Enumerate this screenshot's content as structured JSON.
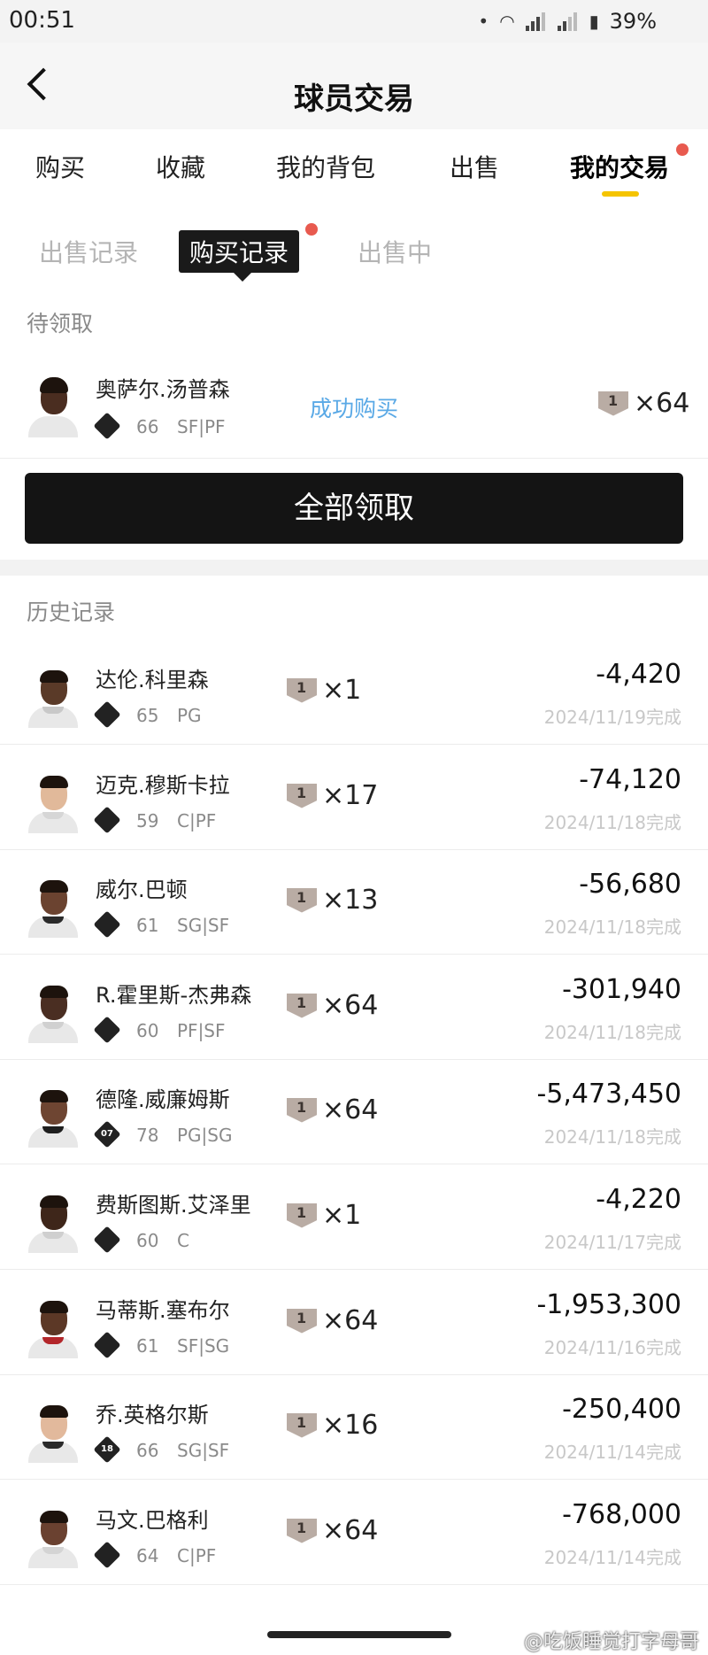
{
  "status_bar": {
    "time": "00:51",
    "battery": "39%"
  },
  "header": {
    "title": "球员交易"
  },
  "main_tabs": [
    {
      "label": "购买"
    },
    {
      "label": "收藏"
    },
    {
      "label": "我的背包"
    },
    {
      "label": "出售"
    },
    {
      "label": "我的交易"
    }
  ],
  "sub_tabs": [
    {
      "label": "出售记录"
    },
    {
      "label": "购买记录"
    },
    {
      "label": "出售中"
    }
  ],
  "pending": {
    "section_label": "待领取",
    "item": {
      "name": "奥萨尔.汤普森",
      "rating": "66",
      "position": "SF|PF",
      "status": "成功购买",
      "card_level": "1",
      "quantity": "×64"
    },
    "claim_all_label": "全部领取"
  },
  "history": {
    "section_label": "历史记录",
    "rows": [
      {
        "name": "达伦.科里森",
        "rating": "65",
        "position": "PG",
        "card_level": "1",
        "quantity": "×1",
        "amount": "-4,420",
        "date": "2024/11/19完成",
        "tier_label": "",
        "skin": "#5a3a28",
        "jersey": "#c8c8c8"
      },
      {
        "name": "迈克.穆斯卡拉",
        "rating": "59",
        "position": "C|PF",
        "card_level": "1",
        "quantity": "×17",
        "amount": "-74,120",
        "date": "2024/11/18完成",
        "tier_label": "",
        "skin": "#e1b99a",
        "jersey": "#d6d6d6"
      },
      {
        "name": "威尔.巴顿",
        "rating": "61",
        "position": "SG|SF",
        "card_level": "1",
        "quantity": "×13",
        "amount": "-56,680",
        "date": "2024/11/18完成",
        "tier_label": "",
        "skin": "#6b4330",
        "jersey": "#2a2a2a"
      },
      {
        "name": "R.霍里斯-杰弗森",
        "rating": "60",
        "position": "PF|SF",
        "card_level": "1",
        "quantity": "×64",
        "amount": "-301,940",
        "date": "2024/11/18完成",
        "tier_label": "",
        "skin": "#4a2e22",
        "jersey": "#d0d0d0"
      },
      {
        "name": "德隆.威廉姆斯",
        "rating": "78",
        "position": "PG|SG",
        "card_level": "1",
        "quantity": "×64",
        "amount": "-5,473,450",
        "date": "2024/11/18完成",
        "tier_label": "07",
        "skin": "#6e4532",
        "jersey": "#1e1e1e"
      },
      {
        "name": "费斯图斯.艾泽里",
        "rating": "60",
        "position": "C",
        "card_level": "1",
        "quantity": "×1",
        "amount": "-4,220",
        "date": "2024/11/17完成",
        "tier_label": "",
        "skin": "#3e261a",
        "jersey": "#cfcfcf"
      },
      {
        "name": "马蒂斯.塞布尔",
        "rating": "61",
        "position": "SF|SG",
        "card_level": "1",
        "quantity": "×64",
        "amount": "-1,953,300",
        "date": "2024/11/16完成",
        "tier_label": "",
        "skin": "#5c3826",
        "jersey": "#b3262a"
      },
      {
        "name": "乔.英格尔斯",
        "rating": "66",
        "position": "SG|SF",
        "card_level": "1",
        "quantity": "×16",
        "amount": "-250,400",
        "date": "2024/11/14完成",
        "tier_label": "18",
        "skin": "#e2b99c",
        "jersey": "#2a2a2a"
      },
      {
        "name": "马文.巴格利",
        "rating": "64",
        "position": "C|PF",
        "card_level": "1",
        "quantity": "×64",
        "amount": "-768,000",
        "date": "2024/11/14完成",
        "tier_label": "",
        "skin": "#6a4130",
        "jersey": "#d4d4d4"
      }
    ]
  },
  "watermark": "@吃饭睡觉打字母哥"
}
